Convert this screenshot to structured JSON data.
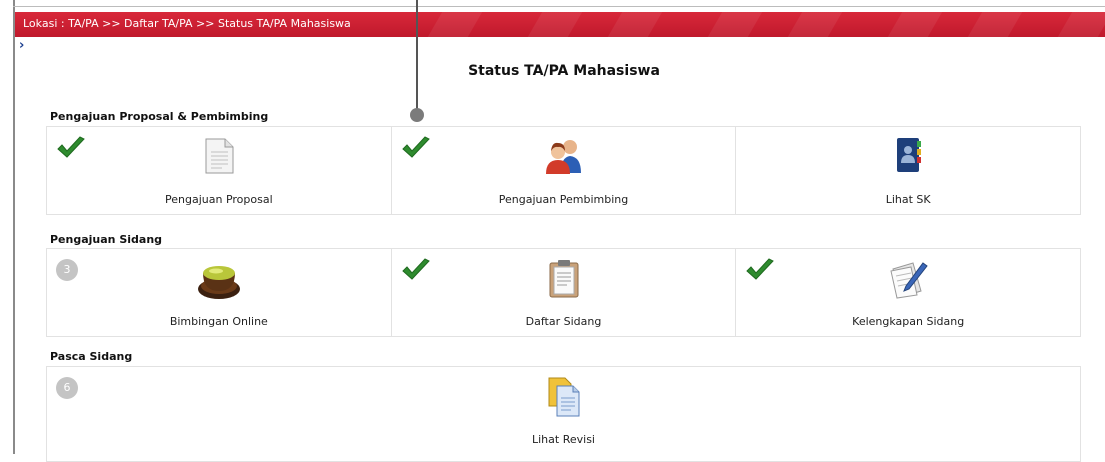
{
  "breadcrumb": "Lokasi : TA/PA >> Daftar TA/PA >> Status TA/PA Mahasiswa",
  "expand_glyph": "›",
  "page_title": "Status TA/PA Mahasiswa",
  "sections": [
    {
      "title": "Pengajuan Proposal & Pembimbing",
      "items": [
        {
          "label": "Pengajuan Proposal",
          "status": "done",
          "icon": "document-icon"
        },
        {
          "label": "Pengajuan Pembimbing",
          "status": "done",
          "icon": "users-icon"
        },
        {
          "label": "Lihat SK",
          "status": "none",
          "icon": "address-book-icon"
        }
      ]
    },
    {
      "title": "Pengajuan Sidang",
      "items": [
        {
          "label": "Bimbingan Online",
          "status": "pending",
          "step": "3",
          "icon": "tea-cup-icon"
        },
        {
          "label": "Daftar Sidang",
          "status": "done",
          "icon": "clipboard-icon"
        },
        {
          "label": "Kelengkapan Sidang",
          "status": "done",
          "icon": "pen-paper-icon"
        }
      ]
    },
    {
      "title": "Pasca Sidang",
      "items": [
        {
          "label": "Lihat Revisi",
          "status": "pending",
          "step": "6",
          "icon": "documents-icon"
        }
      ]
    }
  ],
  "colors": {
    "breadcrumb_bg": "#c91d31",
    "check_green": "#2e8b2e",
    "badge_grey": "#c4c4c4"
  }
}
